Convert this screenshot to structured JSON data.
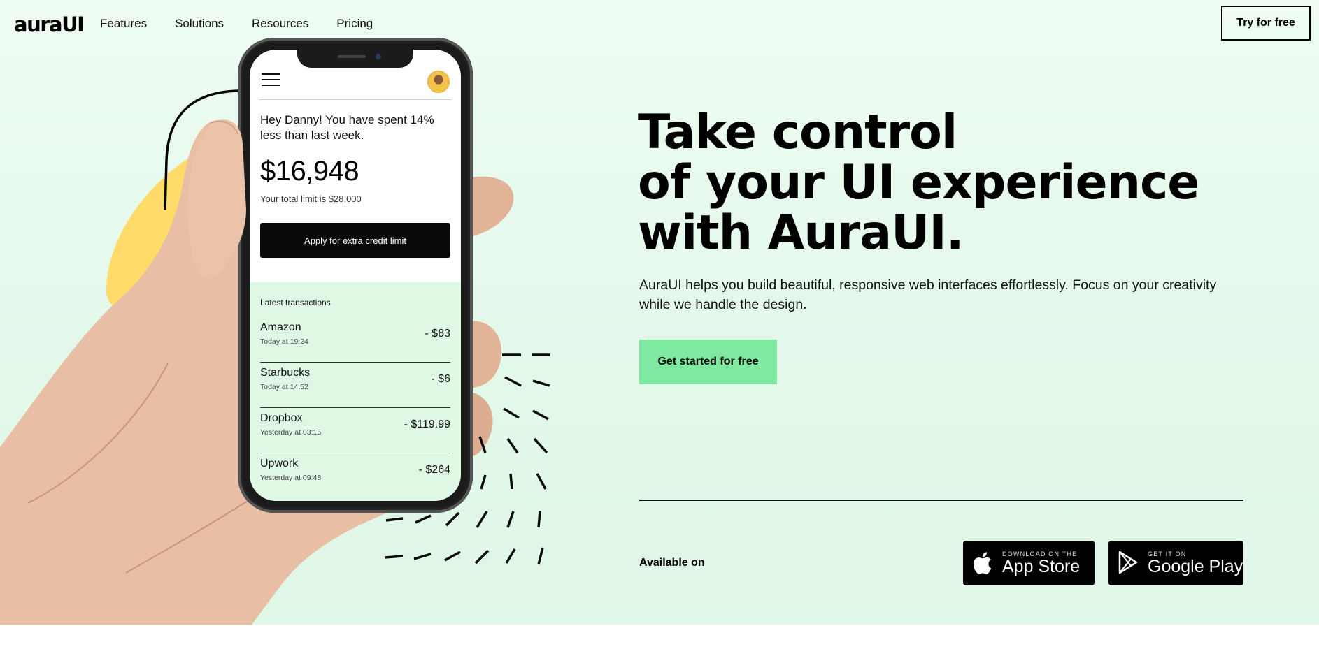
{
  "nav": {
    "logo": "auraUI",
    "links": [
      "Features",
      "Solutions",
      "Resources",
      "Pricing"
    ],
    "try_label": "Try for free"
  },
  "phone": {
    "greeting": "Hey Danny! You have spent 14% less than last week.",
    "balance": "$16,948",
    "limit": "Your total limit is $28,000",
    "credit_button": "Apply for extra credit limit",
    "transactions_heading": "Latest transactions",
    "transactions": [
      {
        "name": "Amazon",
        "time": "Today at 19:24",
        "amount": "- $83"
      },
      {
        "name": "Starbucks",
        "time": "Today at 14:52",
        "amount": "- $6"
      },
      {
        "name": "Dropbox",
        "time": "Yesterday at 03:15",
        "amount": "- $119.99"
      },
      {
        "name": "Upwork",
        "time": "Yesterday at 09:48",
        "amount": "- $264"
      }
    ]
  },
  "hero": {
    "headline": [
      "Take control",
      "of your UI experience",
      "with AuraUI."
    ],
    "subtext": "AuraUI helps you build beautiful, responsive web interfaces effortlessly. Focus on your creativity while we handle the design.",
    "cta_label": "Get started for free",
    "available_label": "Available on"
  },
  "badges": {
    "app_store": {
      "sub": "DOWNLOAD ON THE",
      "main": "App Store",
      "icon": "apple-icon"
    },
    "google_play": {
      "sub": "GET IT ON",
      "main": "Google Play",
      "icon": "play-icon"
    }
  },
  "colors": {
    "background": "#e6f9ec",
    "accent_green": "#7fe8a1",
    "yellow_blob": "#ffdc6a",
    "text": "#0a0a0a"
  }
}
